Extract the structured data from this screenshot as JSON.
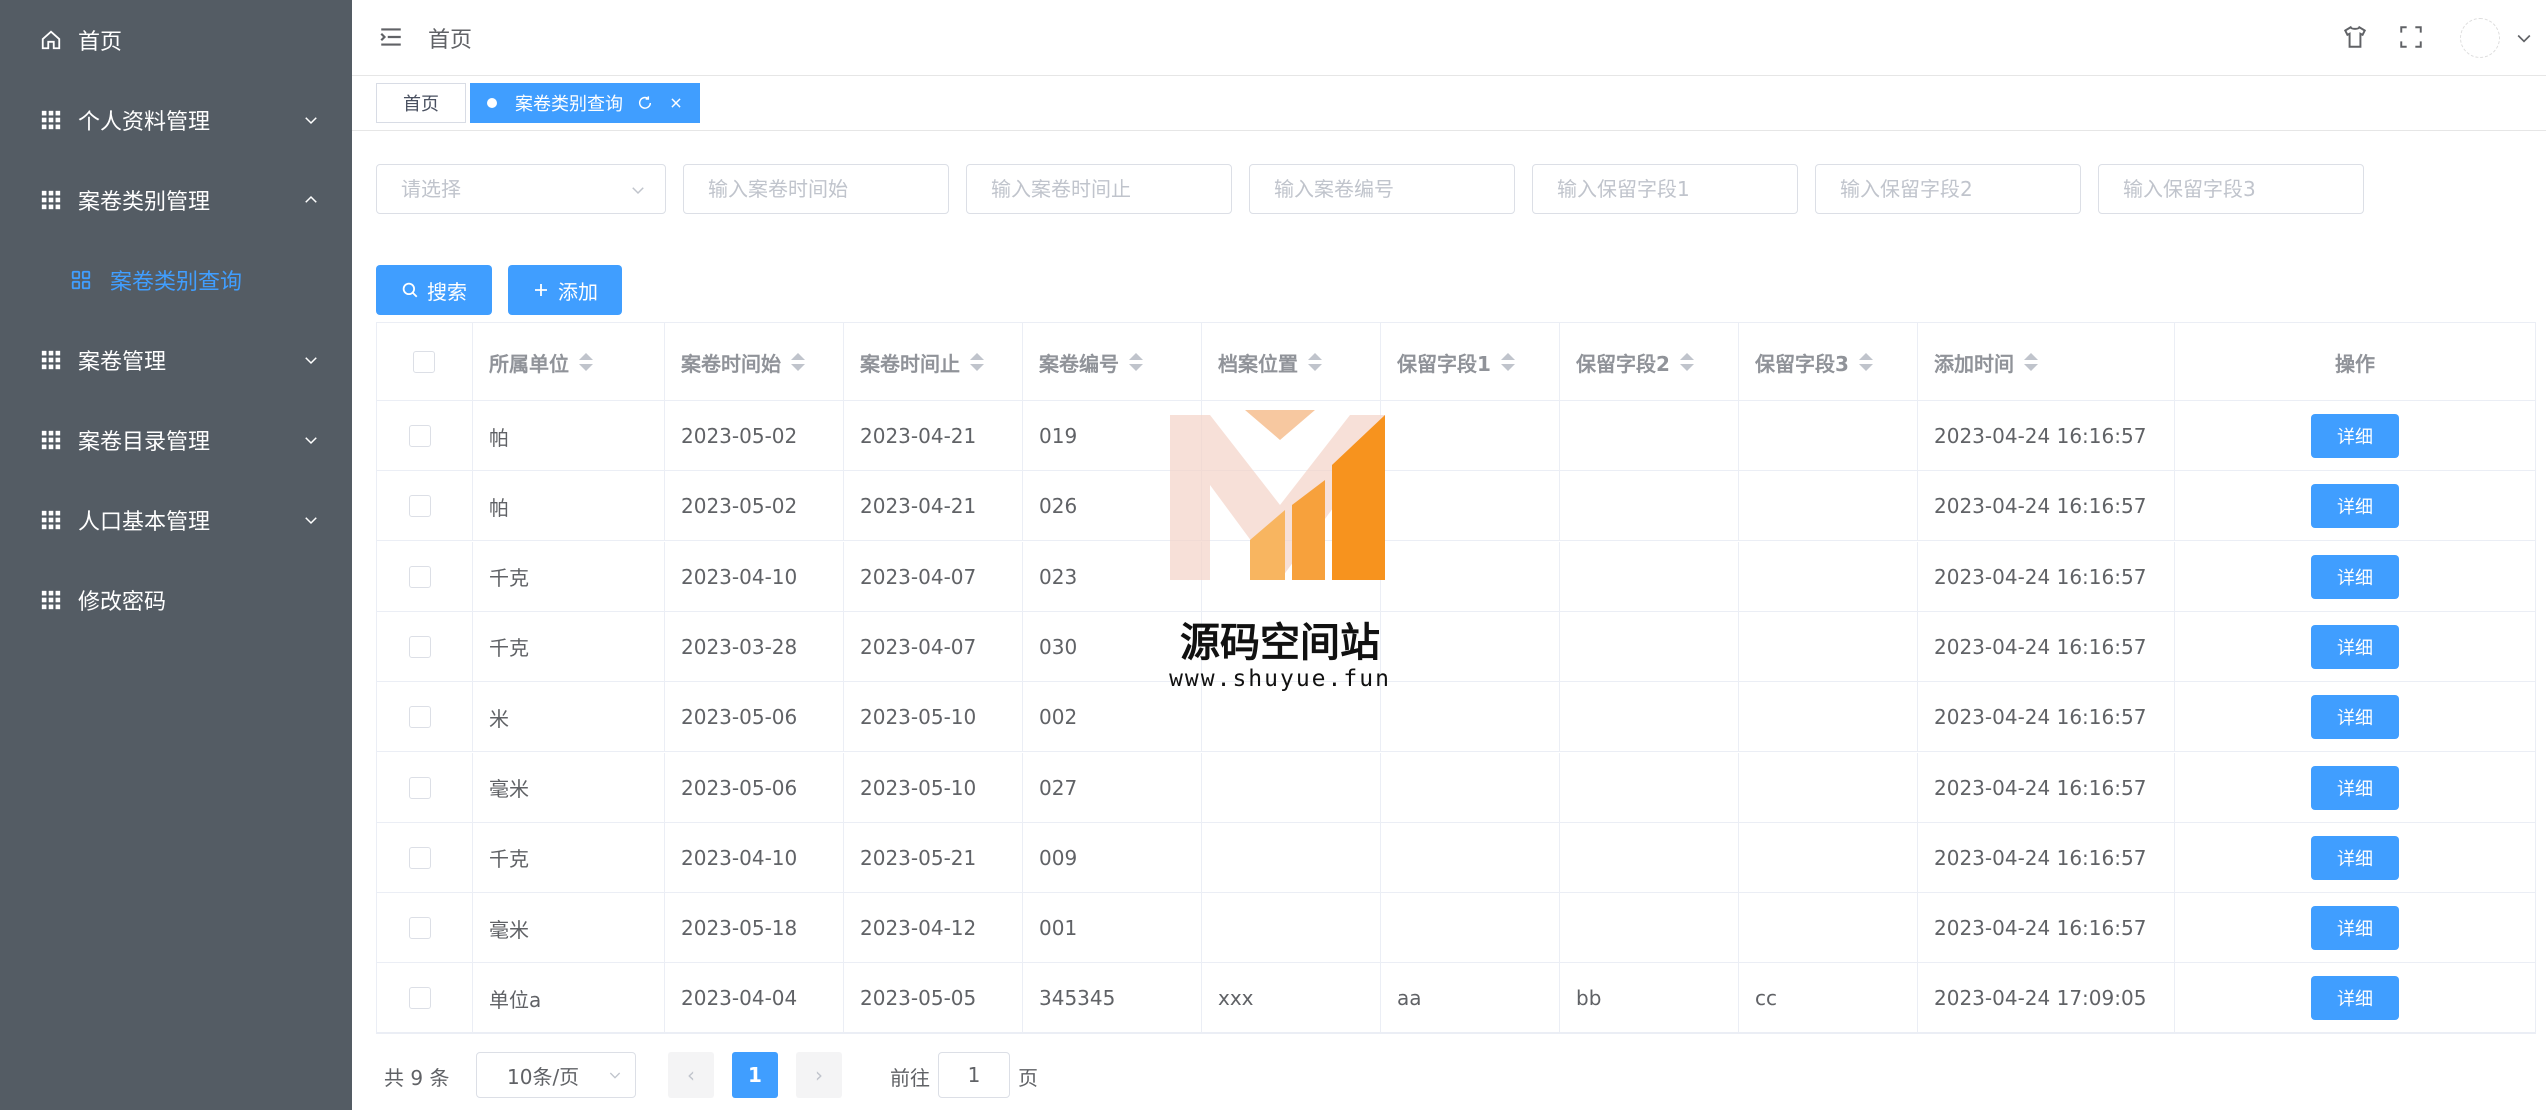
{
  "sidebar": {
    "home": "首页",
    "items": [
      {
        "label": "个人资料管理"
      },
      {
        "label": "案卷类别管理"
      },
      {
        "label": "案卷类别查询"
      },
      {
        "label": "案卷管理"
      },
      {
        "label": "案卷目录管理"
      },
      {
        "label": "人口基本管理"
      },
      {
        "label": "修改密码"
      }
    ]
  },
  "header": {
    "breadcrumb": "首页"
  },
  "tags": {
    "home": "首页",
    "active": "案卷类别查询"
  },
  "filters": {
    "select_placeholder": "请选择",
    "start_placeholder": "输入案卷时间始",
    "end_placeholder": "输入案卷时间止",
    "number_placeholder": "输入案卷编号",
    "field1_placeholder": "输入保留字段1",
    "field2_placeholder": "输入保留字段2",
    "field3_placeholder": "输入保留字段3"
  },
  "toolbar": {
    "search_label": "搜索",
    "add_label": "添加"
  },
  "table": {
    "columns": [
      "所属单位",
      "案卷时间始",
      "案卷时间止",
      "案卷编号",
      "档案位置",
      "保留字段1",
      "保留字段2",
      "保留字段3",
      "添加时间",
      "操作"
    ],
    "rows": [
      {
        "unit": "帕",
        "start": "2023-05-02",
        "end": "2023-04-21",
        "num": "019",
        "loc": "",
        "f1": "",
        "f2": "",
        "f3": "",
        "added": "2023-04-24 16:16:57",
        "action": "详细"
      },
      {
        "unit": "帕",
        "start": "2023-05-02",
        "end": "2023-04-21",
        "num": "026",
        "loc": "",
        "f1": "",
        "f2": "",
        "f3": "",
        "added": "2023-04-24 16:16:57",
        "action": "详细"
      },
      {
        "unit": "千克",
        "start": "2023-04-10",
        "end": "2023-04-07",
        "num": "023",
        "loc": "",
        "f1": "",
        "f2": "",
        "f3": "",
        "added": "2023-04-24 16:16:57",
        "action": "详细"
      },
      {
        "unit": "千克",
        "start": "2023-03-28",
        "end": "2023-04-07",
        "num": "030",
        "loc": "",
        "f1": "",
        "f2": "",
        "f3": "",
        "added": "2023-04-24 16:16:57",
        "action": "详细"
      },
      {
        "unit": "米",
        "start": "2023-05-06",
        "end": "2023-05-10",
        "num": "002",
        "loc": "",
        "f1": "",
        "f2": "",
        "f3": "",
        "added": "2023-04-24 16:16:57",
        "action": "详细"
      },
      {
        "unit": "毫米",
        "start": "2023-05-06",
        "end": "2023-05-10",
        "num": "027",
        "loc": "",
        "f1": "",
        "f2": "",
        "f3": "",
        "added": "2023-04-24 16:16:57",
        "action": "详细"
      },
      {
        "unit": "千克",
        "start": "2023-04-10",
        "end": "2023-05-21",
        "num": "009",
        "loc": "",
        "f1": "",
        "f2": "",
        "f3": "",
        "added": "2023-04-24 16:16:57",
        "action": "详细"
      },
      {
        "unit": "毫米",
        "start": "2023-05-18",
        "end": "2023-04-12",
        "num": "001",
        "loc": "",
        "f1": "",
        "f2": "",
        "f3": "",
        "added": "2023-04-24 16:16:57",
        "action": "详细"
      },
      {
        "unit": "单位a",
        "start": "2023-04-04",
        "end": "2023-05-05",
        "num": "345345",
        "loc": "xxx",
        "f1": "aa",
        "f2": "bb",
        "f3": "cc",
        "added": "2023-04-24 17:09:05",
        "action": "详细"
      }
    ]
  },
  "pagination": {
    "total": "共 9 条",
    "page_size": "10条/页",
    "prev": "‹",
    "current_page": "1",
    "next": "›",
    "goto_label": "前往",
    "goto_value": "1",
    "page_unit": "页"
  },
  "watermark": {
    "title": "源码空间站",
    "url": "www.shuyue.fun"
  },
  "colors": {
    "sidebar_bg": "#545c64",
    "accent": "#409eff",
    "watermark_orange": "#f7931e"
  }
}
